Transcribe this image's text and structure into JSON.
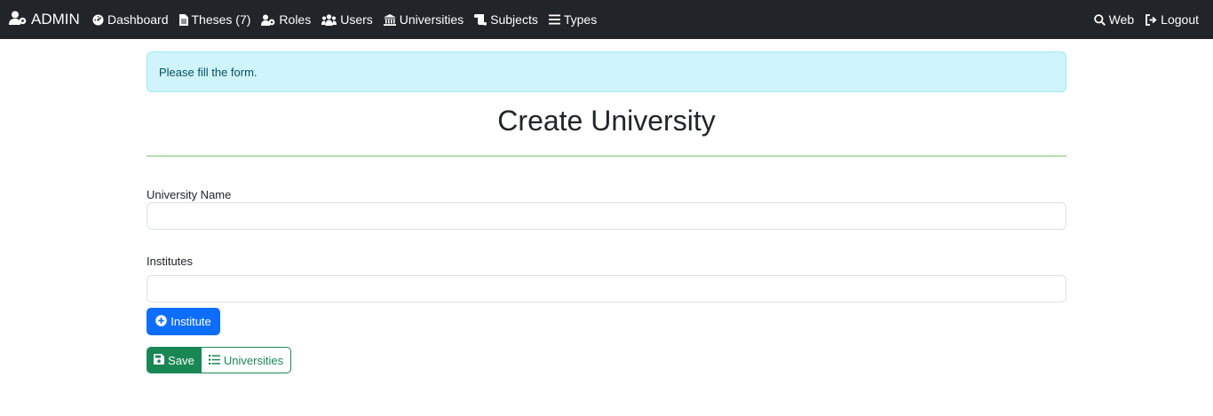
{
  "navbar": {
    "brand": "ADMIN",
    "links": [
      {
        "label": "Dashboard",
        "icon": "dashboard-icon"
      },
      {
        "label": "Theses (7)",
        "icon": "file-icon"
      },
      {
        "label": "Roles",
        "icon": "roles-icon"
      },
      {
        "label": "Users",
        "icon": "users-icon"
      },
      {
        "label": "Universities",
        "icon": "university-icon"
      },
      {
        "label": "Subjects",
        "icon": "scroll-icon"
      },
      {
        "label": "Types",
        "icon": "list-icon"
      }
    ],
    "right_links": [
      {
        "label": "Web",
        "icon": "search-icon"
      },
      {
        "label": "Logout",
        "icon": "logout-icon"
      }
    ]
  },
  "alert": {
    "text": "Please fill the form."
  },
  "page": {
    "title": "Create University"
  },
  "form": {
    "university_name_label": "University Name",
    "university_name_value": "",
    "institutes_label": "Institutes",
    "institutes_value": "",
    "add_institute_label": "Institute",
    "save_label": "Save",
    "universities_label": "Universities"
  },
  "colors": {
    "navbar": "#212529",
    "alert_bg": "#cff4fc",
    "primary": "#0d6efd",
    "success": "#198754",
    "divider": "#b8dcb0"
  }
}
